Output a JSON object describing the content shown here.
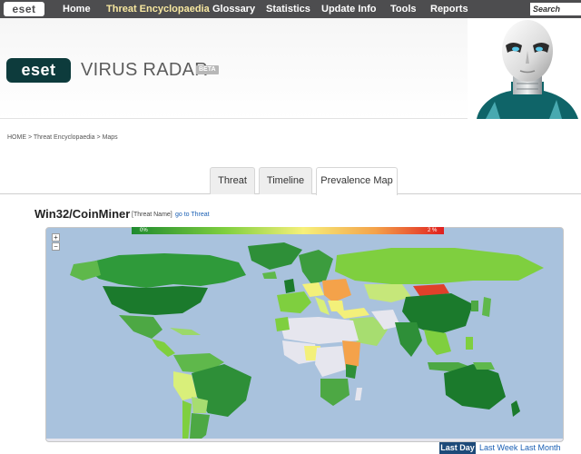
{
  "nav": {
    "logo": "eset",
    "items": [
      {
        "label": "Home"
      },
      {
        "label": "Threat Encyclopaedia"
      },
      {
        "label": "Glossary"
      },
      {
        "label": "Statistics"
      },
      {
        "label": "Update Info"
      },
      {
        "label": "Tools"
      },
      {
        "label": "Reports"
      }
    ],
    "search_placeholder": "Search"
  },
  "header": {
    "logo": "eset",
    "product": "VIRUS RADAR",
    "badge": "BETA"
  },
  "breadcrumb": {
    "home": "HOME",
    "sep1": " > ",
    "encyclopaedia": "Threat Encyclopaedia",
    "sep2": " > ",
    "current": "Maps"
  },
  "tabs": [
    {
      "label": "Threat"
    },
    {
      "label": "Timeline"
    },
    {
      "label": "Prevalence Map",
      "active": true
    }
  ],
  "threat": {
    "name": "Win32/CoinMiner",
    "meta": "[Threat Name]",
    "link": "go to Threat"
  },
  "map": {
    "legend_min": "0%",
    "legend_max": "2 %",
    "zoom_in": "+",
    "zoom_out": "−",
    "colors": {
      "ocean": "#a9c2dd",
      "no_data": "#e6e6ee",
      "low": "#1f8a2f",
      "mid_low": "#7fcf3f",
      "mid": "#f6f07a",
      "mid_high": "#f4a24a",
      "high": "#e01f1f"
    }
  },
  "ranges": [
    {
      "label": "Last Day",
      "active": true
    },
    {
      "label": "Last Week"
    },
    {
      "label": "Last Month"
    }
  ]
}
